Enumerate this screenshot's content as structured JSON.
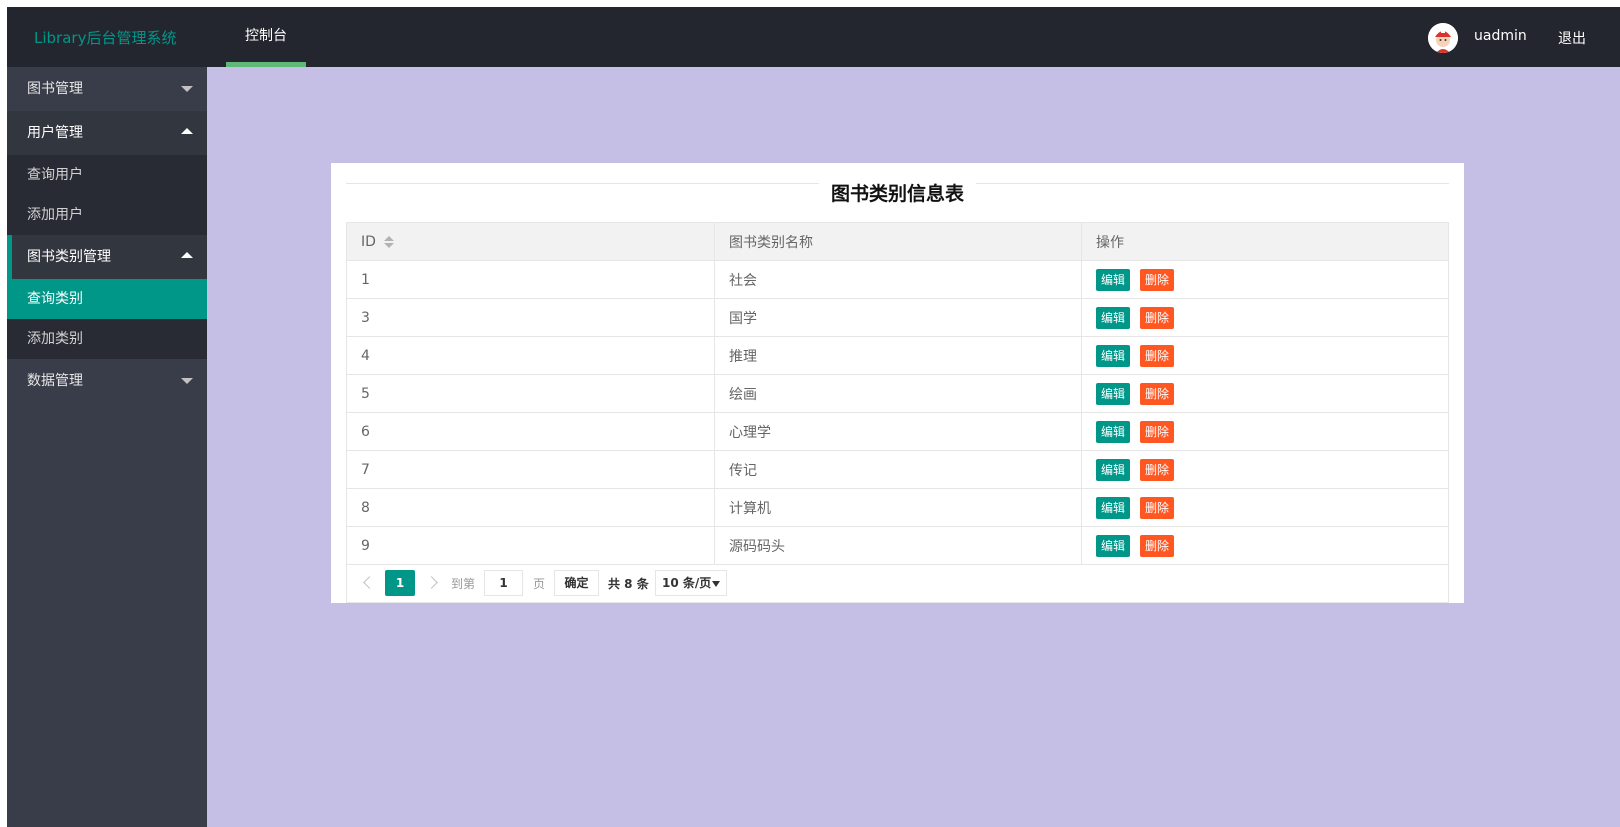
{
  "header": {
    "logo": "Library后台管理系统",
    "nav": "控制台",
    "username": "uadmin",
    "logout": "退出"
  },
  "sidebar": {
    "groups": [
      {
        "label": "图书管理",
        "state": "collapsed"
      },
      {
        "label": "用户管理",
        "state": "expanded",
        "items": [
          "查询用户",
          "添加用户"
        ]
      },
      {
        "label": "图书类别管理",
        "state": "expanded",
        "items": [
          "查询类别",
          "添加类别"
        ],
        "active_item": "查询类别"
      },
      {
        "label": "数据管理",
        "state": "collapsed"
      }
    ]
  },
  "panel": {
    "title": "图书类别信息表",
    "columns": [
      "ID",
      "图书类别名称",
      "操作"
    ],
    "rows": [
      {
        "id": "1",
        "name": "社会"
      },
      {
        "id": "3",
        "name": "国学"
      },
      {
        "id": "4",
        "name": "推理"
      },
      {
        "id": "5",
        "name": "绘画"
      },
      {
        "id": "6",
        "name": "心理学"
      },
      {
        "id": "7",
        "name": "传记"
      },
      {
        "id": "8",
        "name": "计算机"
      },
      {
        "id": "9",
        "name": "源码码头"
      }
    ],
    "edit_label": "编辑",
    "delete_label": "删除"
  },
  "pager": {
    "current": "1",
    "goto_label": "到第",
    "goto_value": "1",
    "page_label": "页",
    "confirm": "确定",
    "count": "共 8 条",
    "limit": "10 条/页"
  },
  "colors": {
    "header_bg": "#23262e",
    "sidebar_bg": "#393d49",
    "accent": "#009688",
    "danger": "#ff5722",
    "content_bg": "#c6bfe5"
  }
}
